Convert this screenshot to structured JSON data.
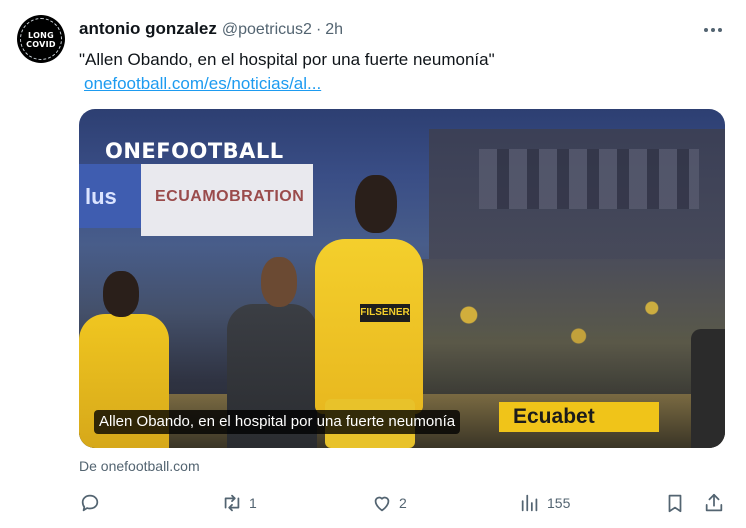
{
  "avatar": {
    "line1": "LONG",
    "line2": "COVID"
  },
  "header": {
    "name": "antonio gonzalez",
    "handle": "@poetricus2",
    "separator": "·",
    "time": "2h"
  },
  "tweet": {
    "text": "\"Allen Obando, en el hospital por una fuerte neumonía\"",
    "link": "onefootball.com/es/noticias/al..."
  },
  "card": {
    "logo": "ONEFOOTBALL",
    "caption": "Allen Obando, en el hospital por una fuerte neumonía",
    "scene_text": {
      "blue_banner": "lus",
      "white_banner": "ECUAMOBRATION",
      "sponsor": "FILSENER",
      "ad": "Ecuabet"
    }
  },
  "source": "De onefootball.com",
  "actions": {
    "reply": {
      "icon": "reply-icon",
      "count": ""
    },
    "retweet": {
      "icon": "retweet-icon",
      "count": "1"
    },
    "like": {
      "icon": "heart-icon",
      "count": "2"
    },
    "views": {
      "icon": "views-icon",
      "count": "155"
    },
    "bookmark": {
      "icon": "bookmark-icon"
    },
    "share": {
      "icon": "share-icon"
    }
  },
  "colors": {
    "link": "#1d9bf0",
    "secondary_text": "#536471",
    "primary_text": "#0f1419"
  }
}
